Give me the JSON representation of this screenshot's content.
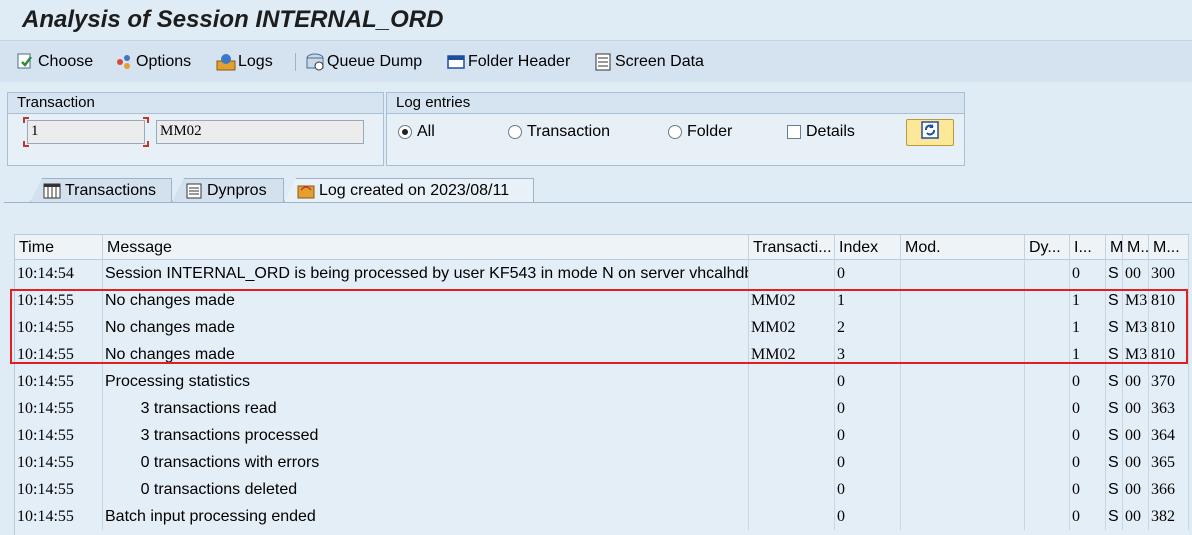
{
  "window": {
    "title": "Analysis of Session INTERNAL_ORD"
  },
  "toolbar": {
    "buttons": [
      {
        "label": "Choose",
        "icon": "choose-icon"
      },
      {
        "label": "Options",
        "icon": "options-icon"
      },
      {
        "label": "Logs",
        "icon": "logs-icon"
      },
      {
        "label": "Queue Dump",
        "icon": "queue-dump-icon"
      },
      {
        "label": "Folder Header",
        "icon": "folder-header-icon"
      },
      {
        "label": "Screen Data",
        "icon": "screen-data-icon"
      }
    ]
  },
  "transaction_group": {
    "title": "Transaction",
    "number_value": "1",
    "code_value": "MM02"
  },
  "log_entries_group": {
    "title": "Log entries",
    "options": [
      {
        "label": "All",
        "selected": true
      },
      {
        "label": "Transaction",
        "selected": false
      },
      {
        "label": "Folder",
        "selected": false
      }
    ],
    "details_label": "Details",
    "details_checked": false
  },
  "tabs": [
    {
      "label": "Transactions",
      "icon": "table-icon",
      "active": false
    },
    {
      "label": "Dynpros",
      "icon": "dynpro-icon",
      "active": false
    },
    {
      "label": "Log created on 2023/08/11",
      "icon": "log-icon",
      "active": true
    }
  ],
  "table": {
    "columns": [
      "Time",
      "Message",
      "Transacti...",
      "Index",
      "Mod.",
      "Dy...",
      "I...",
      "M",
      "M..",
      "M..."
    ],
    "rows": [
      [
        "10:14:54",
        "Session INTERNAL_ORD is being processed by user KF543 in mode N on server vhcalhdb...",
        "",
        "0",
        "",
        "",
        "0",
        "S",
        "00",
        "300"
      ],
      [
        "10:14:55",
        "No changes made",
        "MM02",
        "1",
        "",
        "",
        "1",
        "S",
        "M3",
        "810"
      ],
      [
        "10:14:55",
        "No changes made",
        "MM02",
        "2",
        "",
        "",
        "1",
        "S",
        "M3",
        "810"
      ],
      [
        "10:14:55",
        "No changes made",
        "MM02",
        "3",
        "",
        "",
        "1",
        "S",
        "M3",
        "810"
      ],
      [
        "10:14:55",
        "Processing statistics",
        "",
        "0",
        "",
        "",
        "0",
        "S",
        "00",
        "370"
      ],
      [
        "10:14:55",
        "        3 transactions read",
        "",
        "0",
        "",
        "",
        "0",
        "S",
        "00",
        "363"
      ],
      [
        "10:14:55",
        "        3 transactions processed",
        "",
        "0",
        "",
        "",
        "0",
        "S",
        "00",
        "364"
      ],
      [
        "10:14:55",
        "        0 transactions with errors",
        "",
        "0",
        "",
        "",
        "0",
        "S",
        "00",
        "365"
      ],
      [
        "10:14:55",
        "        0 transactions deleted",
        "",
        "0",
        "",
        "",
        "0",
        "S",
        "00",
        "366"
      ],
      [
        "10:14:55",
        "Batch input processing ended",
        "",
        "0",
        "",
        "",
        "0",
        "S",
        "00",
        "382"
      ]
    ]
  },
  "colors": {
    "highlight": "#e02020",
    "accent": "#fde89a"
  }
}
